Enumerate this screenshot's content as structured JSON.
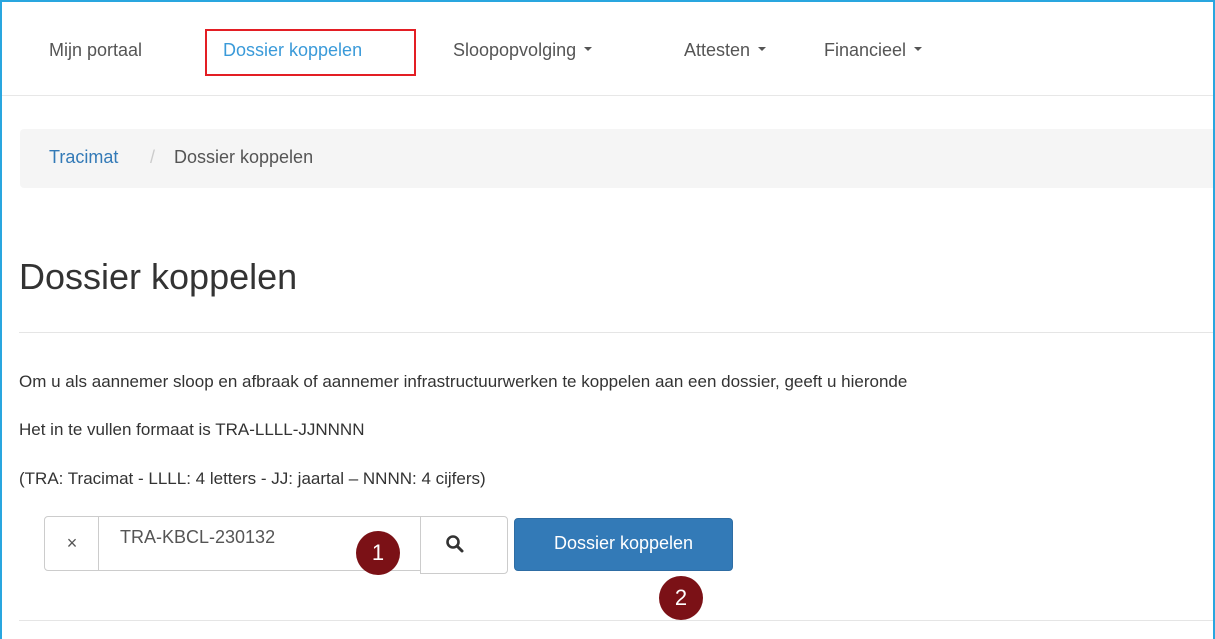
{
  "navbar": {
    "items": [
      {
        "label": "Mijn portaal"
      },
      {
        "label": "Dossier koppelen"
      },
      {
        "label": "Sloopopvolging"
      },
      {
        "label": "Attesten"
      },
      {
        "label": "Financieel"
      }
    ]
  },
  "breadcrumb": {
    "root": "Tracimat",
    "separator": "/",
    "current": "Dossier koppelen"
  },
  "page": {
    "title": "Dossier koppelen",
    "intro": "Om u als aannemer sloop en afbraak of aannemer infrastructuurwerken te koppelen aan een dossier, geeft u hieronde",
    "format_line": "Het in te vullen formaat is TRA-LLLL-JJNNNN",
    "format_legend": "(TRA: Tracimat - LLLL: 4 letters - JJ: jaartal – NNNN: 4 cijfers)"
  },
  "form": {
    "clear_label": "×",
    "code_value": "TRA-KBCL-230132",
    "submit_label": "Dossier koppelen"
  },
  "annotations": {
    "step1": "1",
    "step2": "2"
  },
  "colors": {
    "accent_link": "#337ab7",
    "active_nav": "#3a9ad9",
    "highlight_border": "#e31e24",
    "badge": "#7b1116",
    "frame": "#29a6df"
  },
  "icons": {
    "search": "search-icon",
    "dropdown": "caret-down-icon"
  }
}
